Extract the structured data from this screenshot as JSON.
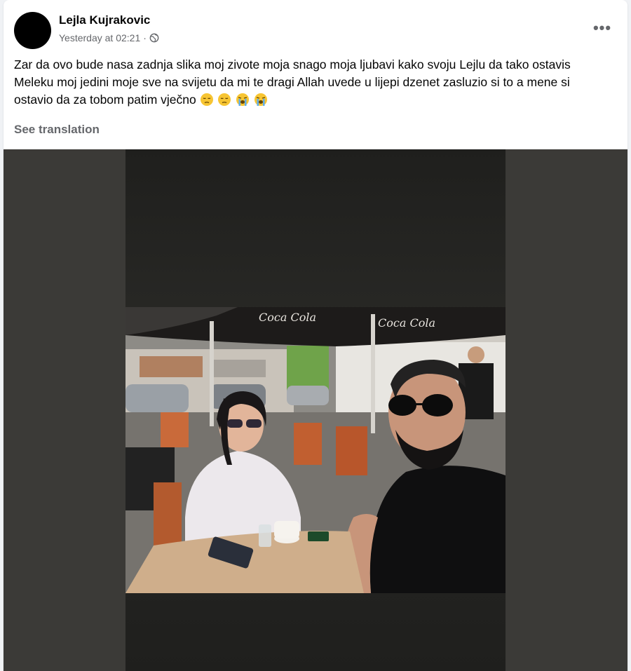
{
  "post": {
    "author": "Lejla Kujrakovic",
    "timestamp": "Yesterday at 02:21",
    "separator": "·",
    "privacy_icon": "globe-icon",
    "more_icon": "more-options-icon",
    "more_label": "•••",
    "text": "Zar da ovo bude nasa zadnja slika moj zivote moja snago moja ljubavi kako svoju Lejlu da tako ostavis Meleku moj jedini moje sve na svijetu da mi te dragi Allah uvede u lijepi dzenet zasluzio si to a mene si ostavio da za tobom patim vječno",
    "emojis": [
      "pensive-face-emoji",
      "pensive-face-emoji",
      "loudly-crying-face-emoji",
      "loudly-crying-face-emoji"
    ],
    "see_translation": "See translation"
  },
  "colors": {
    "background": "#f0f2f5",
    "card": "#ffffff",
    "text_primary": "#050505",
    "text_secondary": "#65676b",
    "media_frame": "#3b3a37"
  }
}
